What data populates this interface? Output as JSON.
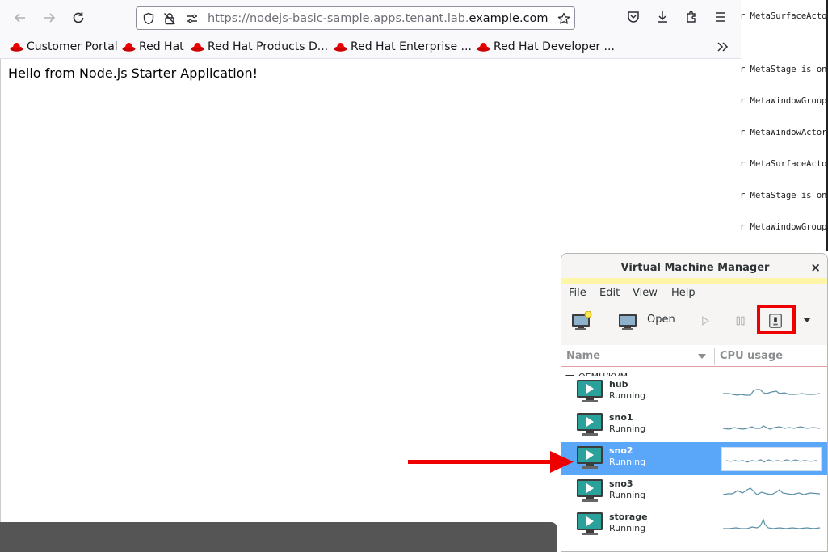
{
  "browser": {
    "url": {
      "prefix": "https://",
      "host_pre": "nodejs-basic-sample.apps.tenant.lab.",
      "host_main": "example.com"
    },
    "bookmarks": [
      "Customer Portal",
      "Red Hat",
      "Red Hat Products D...",
      "Red Hat Enterprise ...",
      "Red Hat Developer ..."
    ],
    "page_text": "Hello from Node.js Starter Application!"
  },
  "terminal": {
    "lines": [
      "r MetaSurfaceActo",
      "r MetaStage is on",
      "r MetaWindowGroup",
      "r MetaWindowActor",
      "r MetaSurfaceActo",
      "r MetaStage is on",
      "r MetaWindowGroup"
    ]
  },
  "vmm": {
    "title": "Virtual Machine Manager",
    "close": "×",
    "menu": [
      "File",
      "Edit",
      "View",
      "Help"
    ],
    "toolbar": {
      "open_label": "Open"
    },
    "columns": {
      "name": "Name",
      "cpu": "CPU usage"
    },
    "group": "QEMU/KVM",
    "vms": [
      {
        "name": "hub",
        "status": "Running",
        "selected": false
      },
      {
        "name": "sno1",
        "status": "Running",
        "selected": false
      },
      {
        "name": "sno2",
        "status": "Running",
        "selected": true
      },
      {
        "name": "sno3",
        "status": "Running",
        "selected": false
      },
      {
        "name": "storage",
        "status": "Running",
        "selected": false
      }
    ]
  },
  "colors": {
    "selection": "#5aa6f8",
    "highlight": "#ee0000",
    "sparkline": "#5b8fa8",
    "taskbar": "#555555"
  }
}
